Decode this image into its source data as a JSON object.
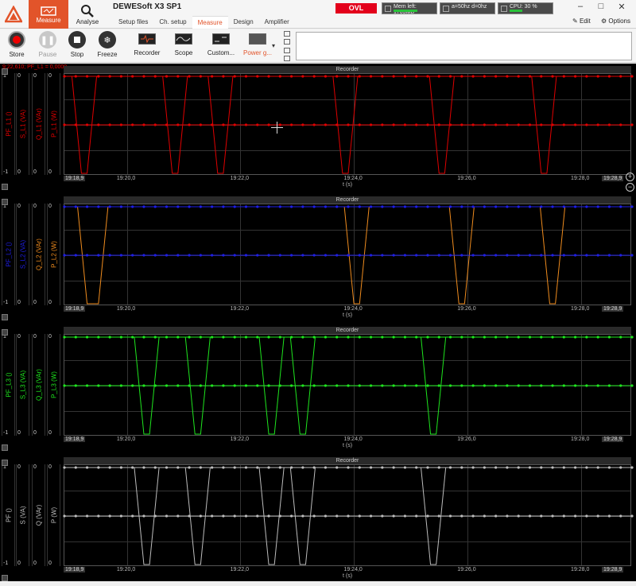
{
  "app": {
    "title": "DEWESoft X3 SP1",
    "modes": [
      {
        "label": "Measure"
      },
      {
        "label": "Analyse"
      }
    ],
    "tabs": [
      "Setup files",
      "Ch. setup",
      "Measure",
      "Design",
      "Amplifier"
    ],
    "active_tab": "Measure",
    "ovl": "OVL",
    "status": {
      "mem": "Mem left: 1703MB",
      "freq": "a=50hz d=0hz",
      "cpu": "CPU: 30 %",
      "cpu_percent": 30
    },
    "edit_label": "Edit",
    "options_label": "Options"
  },
  "toolbar": {
    "store": "Store",
    "pause": "Pause",
    "stop": "Stop",
    "freeze": "Freeze",
    "recorder": "Recorder",
    "scope": "Scope",
    "custom": "Custom...",
    "power": "Power g..."
  },
  "cursor_readout": "9:22,610; PF_L1 = 0,0000",
  "recorder_title": "Recorder",
  "x_axis": {
    "label": "t (s)",
    "start": "19:18,9",
    "end": "19:28,9",
    "ticks": [
      "19:20,0",
      "19:22,0",
      "19:24,0",
      "19:26,0",
      "19:28,0"
    ]
  },
  "panels": [
    {
      "color": "#e00000",
      "axes": [
        {
          "label": "PF_L1 ()",
          "top": "1",
          "bottom": "-1"
        },
        {
          "label": "S_L1 (VA)",
          "top": "0",
          "bottom": "0"
        },
        {
          "label": "Q_L1 (VAr)",
          "top": "0",
          "bottom": "0"
        },
        {
          "label": "P_L1 (W)",
          "top": "0",
          "bottom": "0"
        }
      ],
      "pf_drops": [
        [
          19.25,
          19.35,
          21.85,
          20.75,
          20.85
        ],
        [
          21.55,
          21.65
        ],
        [
          23.7,
          23.8
        ],
        [
          25.5,
          25.6
        ],
        [
          27.3,
          27.4
        ]
      ],
      "series_color_secondary": "#e00000"
    },
    {
      "color": "#1e1ee6",
      "axes": [
        {
          "label": "PF_L2 ()",
          "top": "1",
          "bottom": "-1"
        },
        {
          "label": "S_L2 (VA)",
          "top": "0",
          "bottom": "0"
        },
        {
          "label": "Q_L2 (VAr)",
          "top": "0",
          "bottom": "0"
        },
        {
          "label": "P_L2 (W)",
          "top": "0",
          "bottom": "0"
        }
      ],
      "series_color_secondary": "#f08c1e"
    },
    {
      "color": "#1ee61e",
      "axes": [
        {
          "label": "PF_L3 ()",
          "top": "1",
          "bottom": "-1"
        },
        {
          "label": "S_L3 (VA)",
          "top": "0",
          "bottom": "0"
        },
        {
          "label": "Q_L3 (VAr)",
          "top": "0",
          "bottom": "0"
        },
        {
          "label": "P_L3 (W)",
          "top": "0",
          "bottom": "0"
        }
      ],
      "series_color_secondary": "#1ee61e"
    },
    {
      "color": "#bdbdbd",
      "axes": [
        {
          "label": "PF ()",
          "top": "1",
          "bottom": "-1"
        },
        {
          "label": "S (VA)",
          "top": "0",
          "bottom": "0"
        },
        {
          "label": "Q (VAr)",
          "top": "0",
          "bottom": "0"
        },
        {
          "label": "P (W)",
          "top": "0",
          "bottom": "0"
        }
      ],
      "series_color_secondary": "#bdbdbd"
    }
  ]
}
